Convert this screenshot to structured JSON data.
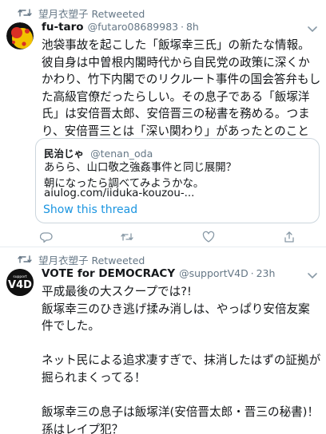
{
  "tweets": [
    {
      "retweet_label": "望月衣塑子 Retweeted",
      "name": "fu-taro",
      "handle": "@futaro08689983",
      "time": "8h",
      "text": "池袋事故を起こした「飯塚幸三氏」の新たな情報。\n彼自身は中曽根内閣時代から自民党の政策に深くかかわり、竹下内閣でのリクルート事件の国会答弁もした高級官僚だったらしい。その息子である「飯塚洋氏」は安倍晋太郎、安倍晋三の秘書を務める。つまり、安倍晋三とは「深い関わり」があったとのこと",
      "quote": {
        "name": "民治じゃ",
        "handle": "@tenan_oda",
        "text": "あらら、山口敬之強姦事件と同じ展開？\n朝になったら調べてみようかな。",
        "link": "aiulog.com/iiduka-kouzou-..."
      },
      "show_thread": "Show this thread"
    },
    {
      "retweet_label": "望月衣塑子 Retweeted",
      "name": "VOTE for DEMOCRACY",
      "handle": "@supportV4D",
      "time": "23h",
      "avatar_text": "V4D",
      "avatar_small_text": "support",
      "text": "平成最後の大スクープでは?!\n飯塚幸三のひき逃げ揉み消しは、やっぱり安倍友案件でした。\n\nネット民による追求凄すぎで、抹消したはずの証拠が掘られまくってる！\n\n飯塚幸三の息子は飯塚洋(安倍晋太郎・晋三の秘書)！孫はレイプ犯？"
    }
  ],
  "colors": {
    "link": "#1b95e0",
    "meta": "#657786",
    "border": "#e6ecf0"
  }
}
